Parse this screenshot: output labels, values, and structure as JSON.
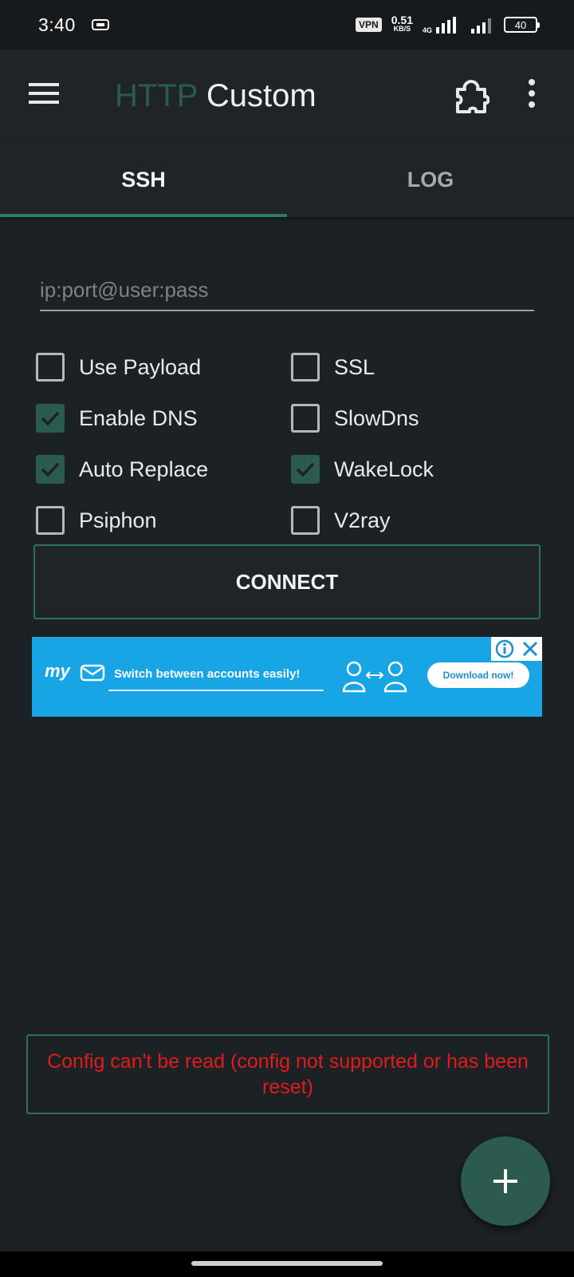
{
  "status_bar": {
    "time": "3:40",
    "vpn": "VPN",
    "speed_value": "0.51",
    "speed_unit": "KB/S",
    "network": "4G",
    "battery": "40"
  },
  "app_bar": {
    "title_accent": "HTTP",
    "title_main": "Custom"
  },
  "tabs": [
    {
      "label": "SSH",
      "active": true
    },
    {
      "label": "LOG",
      "active": false
    }
  ],
  "server_input": {
    "value": "",
    "placeholder": "ip:port@user:pass"
  },
  "options": [
    {
      "label": "Use Payload",
      "checked": false
    },
    {
      "label": "SSL",
      "checked": false
    },
    {
      "label": "Enable DNS",
      "checked": true
    },
    {
      "label": "SlowDns",
      "checked": false
    },
    {
      "label": "Auto Replace",
      "checked": true
    },
    {
      "label": "WakeLock",
      "checked": true
    },
    {
      "label": "Psiphon",
      "checked": false
    },
    {
      "label": "V2ray",
      "checked": false
    }
  ],
  "connect_label": "CONNECT",
  "ad": {
    "logo": "my",
    "text": "Switch between accounts easily!",
    "button": "Download now!"
  },
  "error_message": "Config can't be read (config not supported or has been reset)",
  "colors": {
    "accent": "#2a5b4e",
    "indicator": "#2d7a62",
    "error": "#e21b1b",
    "background": "#1c2125",
    "ad_background": "#17a5e6"
  }
}
